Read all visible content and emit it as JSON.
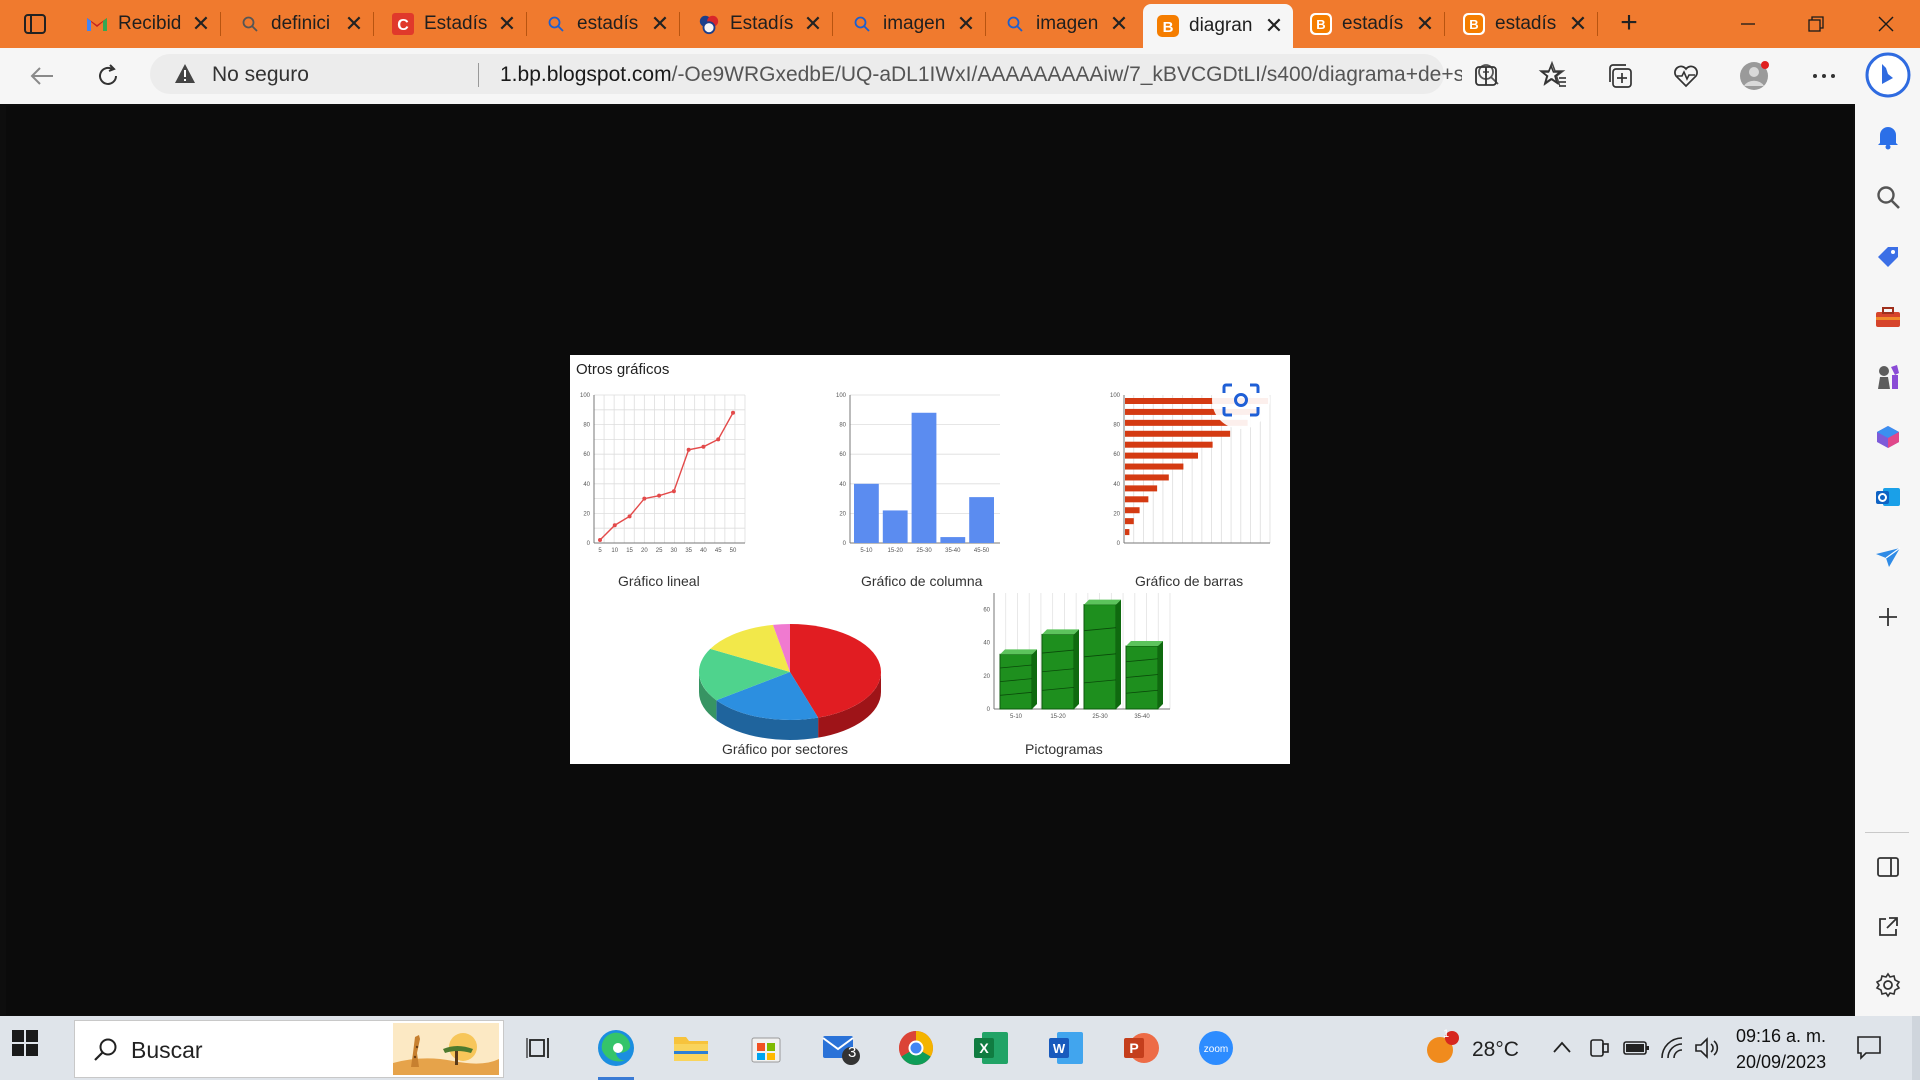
{
  "tabs": [
    {
      "title": "Recibid",
      "icon": "gmail-icon"
    },
    {
      "title": "definici",
      "icon": "search-icon"
    },
    {
      "title": "Estadís",
      "icon": "c-brand-icon"
    },
    {
      "title": "estadís",
      "icon": "search-icon"
    },
    {
      "title": "Estadís",
      "icon": "mixed-logo-icon"
    },
    {
      "title": "imagen",
      "icon": "search-icon"
    },
    {
      "title": "imagen",
      "icon": "search-icon"
    },
    {
      "title": "diagran",
      "icon": "blogger-icon",
      "active": true
    },
    {
      "title": "estadís",
      "icon": "blogger-icon"
    },
    {
      "title": "estadís",
      "icon": "blogger-icon"
    }
  ],
  "address_bar": {
    "security_text": "No seguro",
    "url_host": "1.bp.blogspot.com",
    "url_path": "/-Oe9WRGxedbE/UQ-aDL1IWxI/AAAAAAAAAiw/7_kBVCGDtLI/s400/diagrama+de+s..."
  },
  "image": {
    "title": "Otros gráficos",
    "captions": {
      "line": "Gráfico lineal",
      "column": "Gráfico de columna",
      "bar": "Gráfico de barras",
      "pie": "Gráfico por sectores",
      "picto": "Pictogramas"
    }
  },
  "chart_data": [
    {
      "type": "line",
      "x": [
        5,
        10,
        15,
        20,
        25,
        30,
        35,
        40,
        45,
        50
      ],
      "values": [
        2,
        12,
        18,
        30,
        32,
        35,
        63,
        65,
        70,
        88
      ],
      "ylim": [
        0,
        100
      ],
      "y_ticks": [
        "0",
        "20",
        "40",
        "60",
        "80",
        "100"
      ],
      "grid": true,
      "color": "#e34a4a"
    },
    {
      "type": "bar",
      "categories": [
        "5-10",
        "15-20",
        "25-30",
        "35-40",
        "45-50"
      ],
      "values": [
        40,
        22,
        88,
        4,
        31
      ],
      "ylim": [
        0,
        100
      ],
      "y_ticks": [
        "0",
        "20",
        "40",
        "60",
        "80",
        "100"
      ],
      "color": "#5b8cf0"
    },
    {
      "type": "bar",
      "orientation": "horizontal",
      "values": [
        98,
        92,
        84,
        72,
        60,
        50,
        40,
        30,
        22,
        16,
        10,
        6,
        3
      ],
      "xlim": [
        0,
        100
      ],
      "y_ticks": [
        "0",
        "20",
        "40",
        "60",
        "80",
        "100"
      ],
      "color": "#d43a12"
    },
    {
      "type": "pie",
      "values": [
        45,
        20,
        18,
        14,
        3
      ],
      "colors": [
        "#e11d22",
        "#2c8fe0",
        "#4fd38d",
        "#f2e84a",
        "#f07ad0"
      ]
    },
    {
      "type": "bar",
      "style": "pictogram",
      "categories": [
        "5-10",
        "15-20",
        "25-30",
        "35-40"
      ],
      "values": [
        33,
        45,
        63,
        38
      ],
      "ylim": [
        0,
        70
      ],
      "y_ticks": [
        "0",
        "20",
        "40",
        "60"
      ],
      "color": "#1e8f1e"
    }
  ],
  "taskbar": {
    "search_placeholder": "Buscar",
    "mail_badge": "3",
    "weather_badge": "1",
    "weather_temp": "28°C",
    "time": "09:16 a. m.",
    "date": "20/09/2023"
  },
  "colors": {
    "tabbar": "#f07a2e",
    "toolbar": "#f6f6f6",
    "content_bg": "#0b0b0b",
    "taskbar": "#dfe4ea"
  }
}
